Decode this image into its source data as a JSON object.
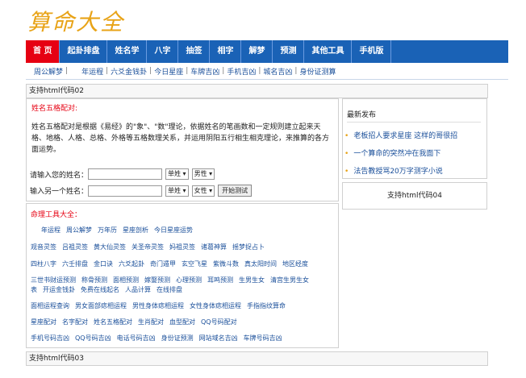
{
  "site": {
    "logo": "算命大全"
  },
  "nav": [
    {
      "label": "首 页"
    },
    {
      "label": "起卦排盘"
    },
    {
      "label": "姓名学"
    },
    {
      "label": "八字"
    },
    {
      "label": "抽签"
    },
    {
      "label": "相字"
    },
    {
      "label": "解梦"
    },
    {
      "label": "预测"
    },
    {
      "label": "其他工具"
    },
    {
      "label": "手机版"
    }
  ],
  "subnav": [
    {
      "label": "周公解梦"
    },
    {
      "label": "年运程"
    },
    {
      "label": "六爻金钱卦"
    },
    {
      "label": "今日星座"
    },
    {
      "label": "车牌吉凶"
    },
    {
      "label": "手机吉凶"
    },
    {
      "label": "城名吉凶"
    },
    {
      "label": "身份证测算"
    }
  ],
  "bars": {
    "top": "支持html代码02",
    "bottom": "支持html代码03",
    "side": "支持html代码04"
  },
  "main": {
    "title": "姓名五格配对:",
    "desc": "姓名五格配对是根据《易经》的\"象\"、\"数\"理论，依据姓名的笔画数和一定规则建立起来天格、地格、人格、总格、外格等五格数理关系，并运用阴阳五行相生相克理论，来推算的各方面运势。",
    "form": {
      "label1": "请输入您的姓名：",
      "label2": "输入另一个姓名：",
      "sel_type": "单姓",
      "sel_gender1": "男性",
      "sel_gender2": "女性",
      "submit": "开始测试"
    }
  },
  "tools": {
    "title": "命理工具大全：",
    "rows": [
      [
        "年运程",
        "周公解梦",
        "万年历",
        "星座剖析",
        "今日星座运势"
      ],
      [
        "观音灵签",
        "吕祖灵签",
        "黄大仙灵签",
        "关圣帝灵签",
        "妈祖灵签",
        "诸葛神算",
        "摇梦捉占卜"
      ],
      [
        "四柱八字",
        "六壬排盘",
        "金口诀",
        "六爻起卦",
        "奇门遁甲",
        "玄空飞星",
        "紫微斗数",
        "真太阳时间",
        "地区经度"
      ],
      [
        "三世书财运预测",
        "称骨预测",
        "面相预测",
        "嫁娶预测",
        "心理预测",
        "耳鸣预测",
        "生男生女",
        "清宫生男生女"
      ],
      [
        "表",
        "开运金钱卦",
        "免费在线起名",
        "人品计算",
        "在线排盘"
      ],
      [
        "面相运程查询",
        "男女面部痣相运程",
        "男性身体痣相运程",
        "女性身体痣相运程",
        "手指指纹算命"
      ],
      [
        "星座配对",
        "名字配对",
        "姓名五格配对",
        "生肖配对",
        "血型配对",
        "QQ号码配对"
      ],
      [
        "手机号码吉凶",
        "QQ号码吉凶",
        "电话号码吉凶",
        "身份证预测",
        "网站域名吉凶",
        "车牌号码吉凶"
      ]
    ]
  },
  "sidebar": {
    "title": "最新发布",
    "items": [
      {
        "label": "老板招人要求星座 这样的哥很招"
      },
      {
        "label": "一个算命的突然冲在我面下"
      },
      {
        "label": "法告教授骂20万字测字小说"
      }
    ]
  }
}
